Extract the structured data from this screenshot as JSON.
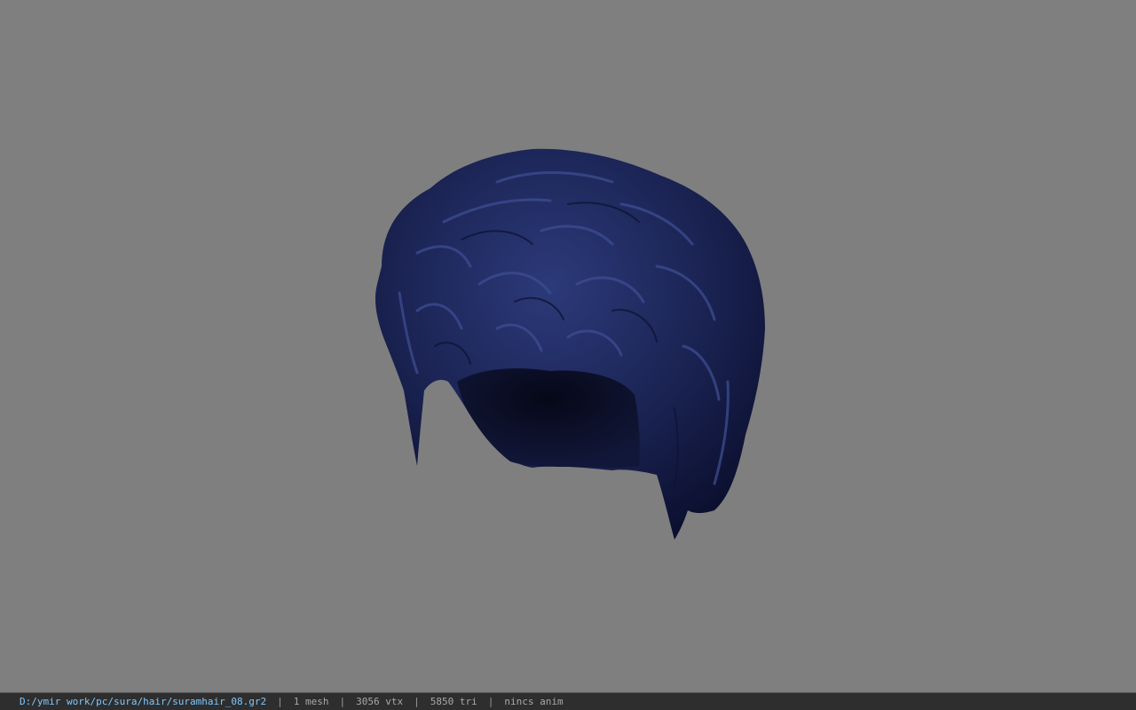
{
  "viewport": {
    "background_color": "#7f7f7f",
    "model_color": "#1b2454",
    "model": "hair-mesh"
  },
  "statusbar": {
    "file_path": "D:/ymir work/pc/sura/hair/suramhair_08.gr2",
    "separator": "|",
    "mesh_count": "1 mesh",
    "vertex_count": "3056 vtx",
    "triangle_count": "5850 tri",
    "anim_info": "nincs anim"
  }
}
